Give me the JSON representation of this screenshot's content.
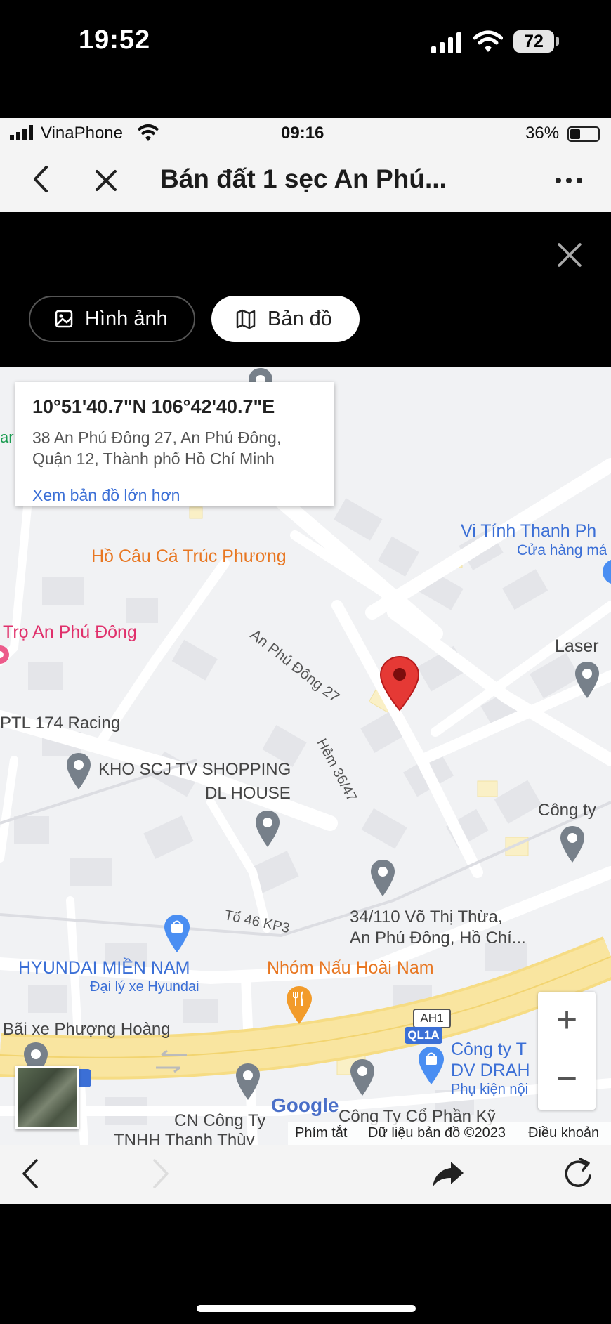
{
  "os_status": {
    "time": "19:52",
    "battery": "72"
  },
  "inner_status": {
    "carrier": "VinaPhone",
    "time": "09:16",
    "battery_percent": "36%"
  },
  "nav": {
    "title": "Bán đất 1 sẹc An Phú..."
  },
  "viewer": {
    "tabs": [
      {
        "label": "Hình ảnh",
        "icon": "image-icon",
        "selected": false
      },
      {
        "label": "Bản đồ",
        "icon": "map-icon",
        "selected": true
      }
    ]
  },
  "map": {
    "info_card": {
      "coordinates": "10°51'40.7\"N 106°42'40.7\"E",
      "address_line1": "38 An Phú Đông 27, An Phú Đông,",
      "address_line2": "Quận 12, Thành phố Hồ Chí Minh",
      "link": "Xem bản đồ lớn hơn"
    },
    "labels": {
      "ho_cau": "Hồ Câu Cá Trúc Phương",
      "vi_tinh": "Vi Tính Thanh Ph",
      "cua_hang": "Cửa hàng má",
      "tro": "Trọ An Phú Đông",
      "laser": "Laser",
      "road_apd27": "An Phú Đông 27",
      "racing": "PTL 174 Racing",
      "kho_scj": "KHO SCJ TV SHOPPING",
      "dl_house": "DL HOUSE",
      "hem": "Hẻm 36/47",
      "cong_ty_right": "Công ty",
      "to46": "Tổ 46 KP3",
      "vo_thi_thua_1": "34/110 Võ Thị Thừa,",
      "vo_thi_thua_2": "An Phú Đông, Hồ Chí...",
      "hyundai": "HYUNDAI MIỀN NAM",
      "hyundai_sub": "Đại lý xe Hyundai",
      "nhom_nau": "Nhóm Nấu Hoài Nam",
      "ah1": "AH1",
      "ql1a": "QL1A",
      "bai_xe": "Bãi xe Phượng Hoàng",
      "cong_ty_t": "Công ty T",
      "dv_drah": "DV DRAH",
      "phu_kien": "Phụ kiện nội",
      "google": "Google",
      "cn_cong_ty": "CN Công Ty",
      "tnhh": "TNHH Thanh Thùy",
      "cong_ty_co_phan": "Công Ty Cổ Phần Kỹ",
      "left_ar": "ar"
    },
    "attribution": {
      "shortcuts": "Phím tắt",
      "map_data": "Dữ liệu bản đồ ©2023",
      "terms": "Điều khoản"
    },
    "zoom": {
      "in": "+",
      "out": "−"
    }
  }
}
